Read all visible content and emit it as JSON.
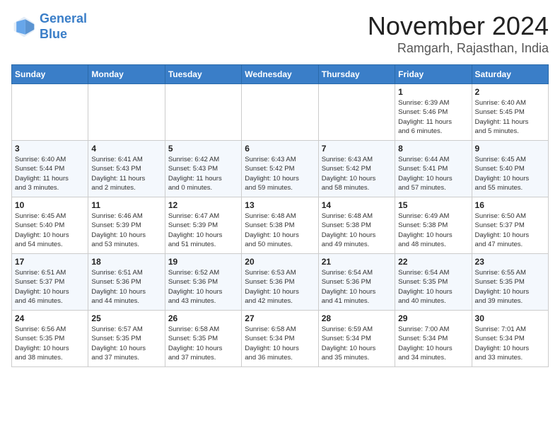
{
  "logo": {
    "line1": "General",
    "line2": "Blue"
  },
  "title": "November 2024",
  "location": "Ramgarh, Rajasthan, India",
  "weekdays": [
    "Sunday",
    "Monday",
    "Tuesday",
    "Wednesday",
    "Thursday",
    "Friday",
    "Saturday"
  ],
  "weeks": [
    [
      {
        "day": "",
        "info": ""
      },
      {
        "day": "",
        "info": ""
      },
      {
        "day": "",
        "info": ""
      },
      {
        "day": "",
        "info": ""
      },
      {
        "day": "",
        "info": ""
      },
      {
        "day": "1",
        "info": "Sunrise: 6:39 AM\nSunset: 5:46 PM\nDaylight: 11 hours\nand 6 minutes."
      },
      {
        "day": "2",
        "info": "Sunrise: 6:40 AM\nSunset: 5:45 PM\nDaylight: 11 hours\nand 5 minutes."
      }
    ],
    [
      {
        "day": "3",
        "info": "Sunrise: 6:40 AM\nSunset: 5:44 PM\nDaylight: 11 hours\nand 3 minutes."
      },
      {
        "day": "4",
        "info": "Sunrise: 6:41 AM\nSunset: 5:43 PM\nDaylight: 11 hours\nand 2 minutes."
      },
      {
        "day": "5",
        "info": "Sunrise: 6:42 AM\nSunset: 5:43 PM\nDaylight: 11 hours\nand 0 minutes."
      },
      {
        "day": "6",
        "info": "Sunrise: 6:43 AM\nSunset: 5:42 PM\nDaylight: 10 hours\nand 59 minutes."
      },
      {
        "day": "7",
        "info": "Sunrise: 6:43 AM\nSunset: 5:42 PM\nDaylight: 10 hours\nand 58 minutes."
      },
      {
        "day": "8",
        "info": "Sunrise: 6:44 AM\nSunset: 5:41 PM\nDaylight: 10 hours\nand 57 minutes."
      },
      {
        "day": "9",
        "info": "Sunrise: 6:45 AM\nSunset: 5:40 PM\nDaylight: 10 hours\nand 55 minutes."
      }
    ],
    [
      {
        "day": "10",
        "info": "Sunrise: 6:45 AM\nSunset: 5:40 PM\nDaylight: 10 hours\nand 54 minutes."
      },
      {
        "day": "11",
        "info": "Sunrise: 6:46 AM\nSunset: 5:39 PM\nDaylight: 10 hours\nand 53 minutes."
      },
      {
        "day": "12",
        "info": "Sunrise: 6:47 AM\nSunset: 5:39 PM\nDaylight: 10 hours\nand 51 minutes."
      },
      {
        "day": "13",
        "info": "Sunrise: 6:48 AM\nSunset: 5:38 PM\nDaylight: 10 hours\nand 50 minutes."
      },
      {
        "day": "14",
        "info": "Sunrise: 6:48 AM\nSunset: 5:38 PM\nDaylight: 10 hours\nand 49 minutes."
      },
      {
        "day": "15",
        "info": "Sunrise: 6:49 AM\nSunset: 5:38 PM\nDaylight: 10 hours\nand 48 minutes."
      },
      {
        "day": "16",
        "info": "Sunrise: 6:50 AM\nSunset: 5:37 PM\nDaylight: 10 hours\nand 47 minutes."
      }
    ],
    [
      {
        "day": "17",
        "info": "Sunrise: 6:51 AM\nSunset: 5:37 PM\nDaylight: 10 hours\nand 46 minutes."
      },
      {
        "day": "18",
        "info": "Sunrise: 6:51 AM\nSunset: 5:36 PM\nDaylight: 10 hours\nand 44 minutes."
      },
      {
        "day": "19",
        "info": "Sunrise: 6:52 AM\nSunset: 5:36 PM\nDaylight: 10 hours\nand 43 minutes."
      },
      {
        "day": "20",
        "info": "Sunrise: 6:53 AM\nSunset: 5:36 PM\nDaylight: 10 hours\nand 42 minutes."
      },
      {
        "day": "21",
        "info": "Sunrise: 6:54 AM\nSunset: 5:36 PM\nDaylight: 10 hours\nand 41 minutes."
      },
      {
        "day": "22",
        "info": "Sunrise: 6:54 AM\nSunset: 5:35 PM\nDaylight: 10 hours\nand 40 minutes."
      },
      {
        "day": "23",
        "info": "Sunrise: 6:55 AM\nSunset: 5:35 PM\nDaylight: 10 hours\nand 39 minutes."
      }
    ],
    [
      {
        "day": "24",
        "info": "Sunrise: 6:56 AM\nSunset: 5:35 PM\nDaylight: 10 hours\nand 38 minutes."
      },
      {
        "day": "25",
        "info": "Sunrise: 6:57 AM\nSunset: 5:35 PM\nDaylight: 10 hours\nand 37 minutes."
      },
      {
        "day": "26",
        "info": "Sunrise: 6:58 AM\nSunset: 5:35 PM\nDaylight: 10 hours\nand 37 minutes."
      },
      {
        "day": "27",
        "info": "Sunrise: 6:58 AM\nSunset: 5:34 PM\nDaylight: 10 hours\nand 36 minutes."
      },
      {
        "day": "28",
        "info": "Sunrise: 6:59 AM\nSunset: 5:34 PM\nDaylight: 10 hours\nand 35 minutes."
      },
      {
        "day": "29",
        "info": "Sunrise: 7:00 AM\nSunset: 5:34 PM\nDaylight: 10 hours\nand 34 minutes."
      },
      {
        "day": "30",
        "info": "Sunrise: 7:01 AM\nSunset: 5:34 PM\nDaylight: 10 hours\nand 33 minutes."
      }
    ]
  ]
}
